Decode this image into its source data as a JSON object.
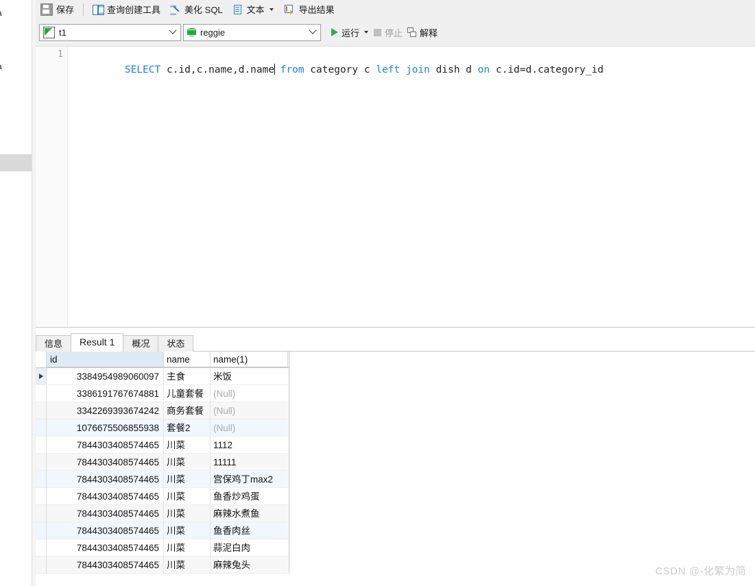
{
  "sidebar": {
    "clipped_labels": [
      "ma",
      "ma"
    ]
  },
  "toolbar": {
    "items": [
      {
        "icon": "save-icon",
        "label": "保存",
        "name": "save-button"
      },
      {
        "icon": "query-builder-icon",
        "label": "查询创建工具",
        "name": "query-builder-button"
      },
      {
        "icon": "beautify-icon",
        "label": "美化 SQL",
        "name": "beautify-sql-button"
      },
      {
        "icon": "text-icon",
        "label": "文本",
        "name": "text-button"
      },
      {
        "icon": "export-icon",
        "label": "导出结果",
        "name": "export-results-button"
      }
    ]
  },
  "toolbar2": {
    "table_combo": {
      "value": "t1",
      "icon": "table-icon"
    },
    "db_combo": {
      "value": "reggie",
      "icon": "database-icon"
    },
    "run_label": "运行",
    "stop_label": "停止",
    "explain_label": "解释"
  },
  "editor": {
    "line_number": "1",
    "tokens": [
      {
        "t": "SELECT",
        "k": true
      },
      {
        "t": " c.id,c.name,d.name",
        "k": false
      },
      {
        "t": "CARET",
        "k": false
      },
      {
        "t": " from",
        "k": true
      },
      {
        "t": " category c",
        "k": false
      },
      {
        "t": " left join",
        "k": true
      },
      {
        "t": " dish d",
        "k": false
      },
      {
        "t": " on",
        "k": true
      },
      {
        "t": " c.id=d.category_id",
        "k": false
      }
    ],
    "full_text": "SELECT c.id,c.name,d.name from category c left join dish d on c.id=d.category_id"
  },
  "tabs": [
    {
      "label": "信息",
      "active": false,
      "name": "tab-info"
    },
    {
      "label": "Result 1",
      "active": true,
      "name": "tab-result-1"
    },
    {
      "label": "概况",
      "active": false,
      "name": "tab-profile"
    },
    {
      "label": "状态",
      "active": false,
      "name": "tab-status"
    }
  ],
  "result_grid": {
    "columns": [
      "id",
      "name",
      "name(1)"
    ],
    "selected_column": "id",
    "current_row": 0,
    "rows": [
      {
        "id": "3384954989060097",
        "name": "主食",
        "name1": "米饭",
        "null1": false
      },
      {
        "id": "3386191767674881",
        "name": "儿童套餐",
        "name1": "(Null)",
        "null1": true
      },
      {
        "id": "3342269393674242",
        "name": "商务套餐",
        "name1": "(Null)",
        "null1": true
      },
      {
        "id": "1076675506855938",
        "name": "套餐2",
        "name1": "(Null)",
        "null1": true
      },
      {
        "id": "7844303408574465",
        "name": "川菜",
        "name1": "1112",
        "null1": false
      },
      {
        "id": "7844303408574465",
        "name": "川菜",
        "name1": "11111",
        "null1": false
      },
      {
        "id": "7844303408574465",
        "name": "川菜",
        "name1": "宫保鸡丁max2",
        "null1": false
      },
      {
        "id": "7844303408574465",
        "name": "川菜",
        "name1": "鱼香炒鸡蛋",
        "null1": false
      },
      {
        "id": "7844303408574465",
        "name": "川菜",
        "name1": "麻辣水煮鱼",
        "null1": false
      },
      {
        "id": "7844303408574465",
        "name": "川菜",
        "name1": "鱼香肉丝",
        "null1": false
      },
      {
        "id": "7844303408574465",
        "name": "川菜",
        "name1": "蒜泥白肉",
        "null1": false
      },
      {
        "id": "7844303408574465",
        "name": "川菜",
        "name1": "麻辣兔头",
        "null1": false
      }
    ]
  },
  "watermark": {
    "text": "CSDN @-化繁为简"
  },
  "colors": {
    "toolbar_bg": "#f0f0f0",
    "keyword": "#1a7ff0",
    "run_green": "#2bb14a",
    "selected_column_header": "#ddeaf6",
    "null_text": "#a9a9a9",
    "watermark": "#cdcdcd"
  }
}
